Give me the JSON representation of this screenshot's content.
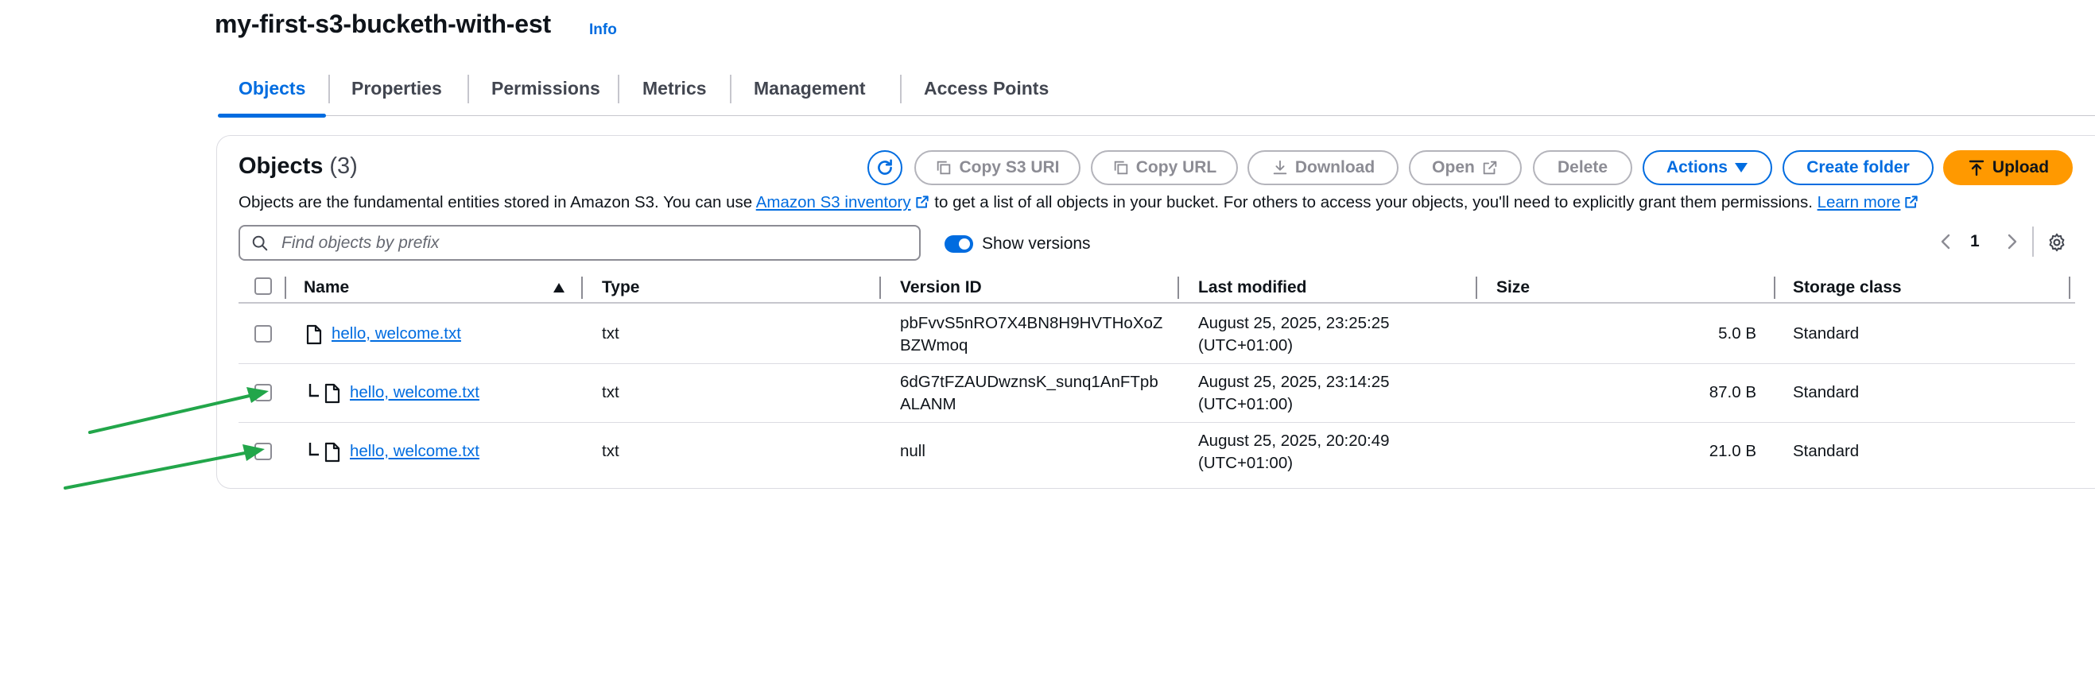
{
  "bucket": {
    "name": "my-first-s3-bucketh-with-est",
    "info_label": "Info"
  },
  "tabs": [
    {
      "label": "Objects"
    },
    {
      "label": "Properties"
    },
    {
      "label": "Permissions"
    },
    {
      "label": "Metrics"
    },
    {
      "label": "Management"
    },
    {
      "label": "Access Points"
    }
  ],
  "objects": {
    "heading": "Objects",
    "count": "(3)",
    "buttons": {
      "copy_s3_uri": "Copy S3 URI",
      "copy_url": "Copy URL",
      "download": "Download",
      "open": "Open",
      "delete": "Delete",
      "actions": "Actions",
      "create_folder": "Create folder",
      "upload": "Upload"
    },
    "description": {
      "part1": "Objects are the fundamental entities stored in Amazon S3. You can use ",
      "link1": "Amazon S3 inventory",
      "part2": " to get a list of all objects in your bucket. For others to access your objects, you'll need to explicitly grant them permissions. ",
      "link2": "Learn more"
    },
    "search": {
      "placeholder": "Find objects by prefix",
      "value": ""
    },
    "show_versions": {
      "label": "Show versions",
      "on": true
    },
    "pagination": {
      "current_page": "1"
    }
  },
  "table": {
    "columns": [
      "Name",
      "Type",
      "Version ID",
      "Last modified",
      "Size",
      "Storage class"
    ],
    "rows": [
      {
        "name": "hello, welcome.txt",
        "type": "txt",
        "version_line1": "pbFvvS5nRO7X4BN8H9HVTHoXoZ",
        "version_line2": "BZWmoq",
        "modified_line1": "August 25, 2025, 23:25:25",
        "modified_line2": "(UTC+01:00)",
        "size": "5.0 B",
        "storage": "Standard"
      },
      {
        "name": "hello, welcome.txt",
        "type": "txt",
        "version_line1": "6dG7tFZAUDwznsK_sunq1AnFTpb",
        "version_line2": "ALANM",
        "modified_line1": "August 25, 2025, 23:14:25",
        "modified_line2": "(UTC+01:00)",
        "size": "87.0 B",
        "storage": "Standard"
      },
      {
        "name": "hello, welcome.txt",
        "type": "txt",
        "version_line1": "null",
        "version_line2": "",
        "modified_line1": "August 25, 2025, 20:20:49",
        "modified_line2": "(UTC+01:00)",
        "size": "21.0 B",
        "storage": "Standard"
      }
    ]
  },
  "colors": {
    "link_blue": "#006ce0",
    "upload_orange": "#ff9900",
    "annotation_arrow_green": "#22a64a"
  }
}
